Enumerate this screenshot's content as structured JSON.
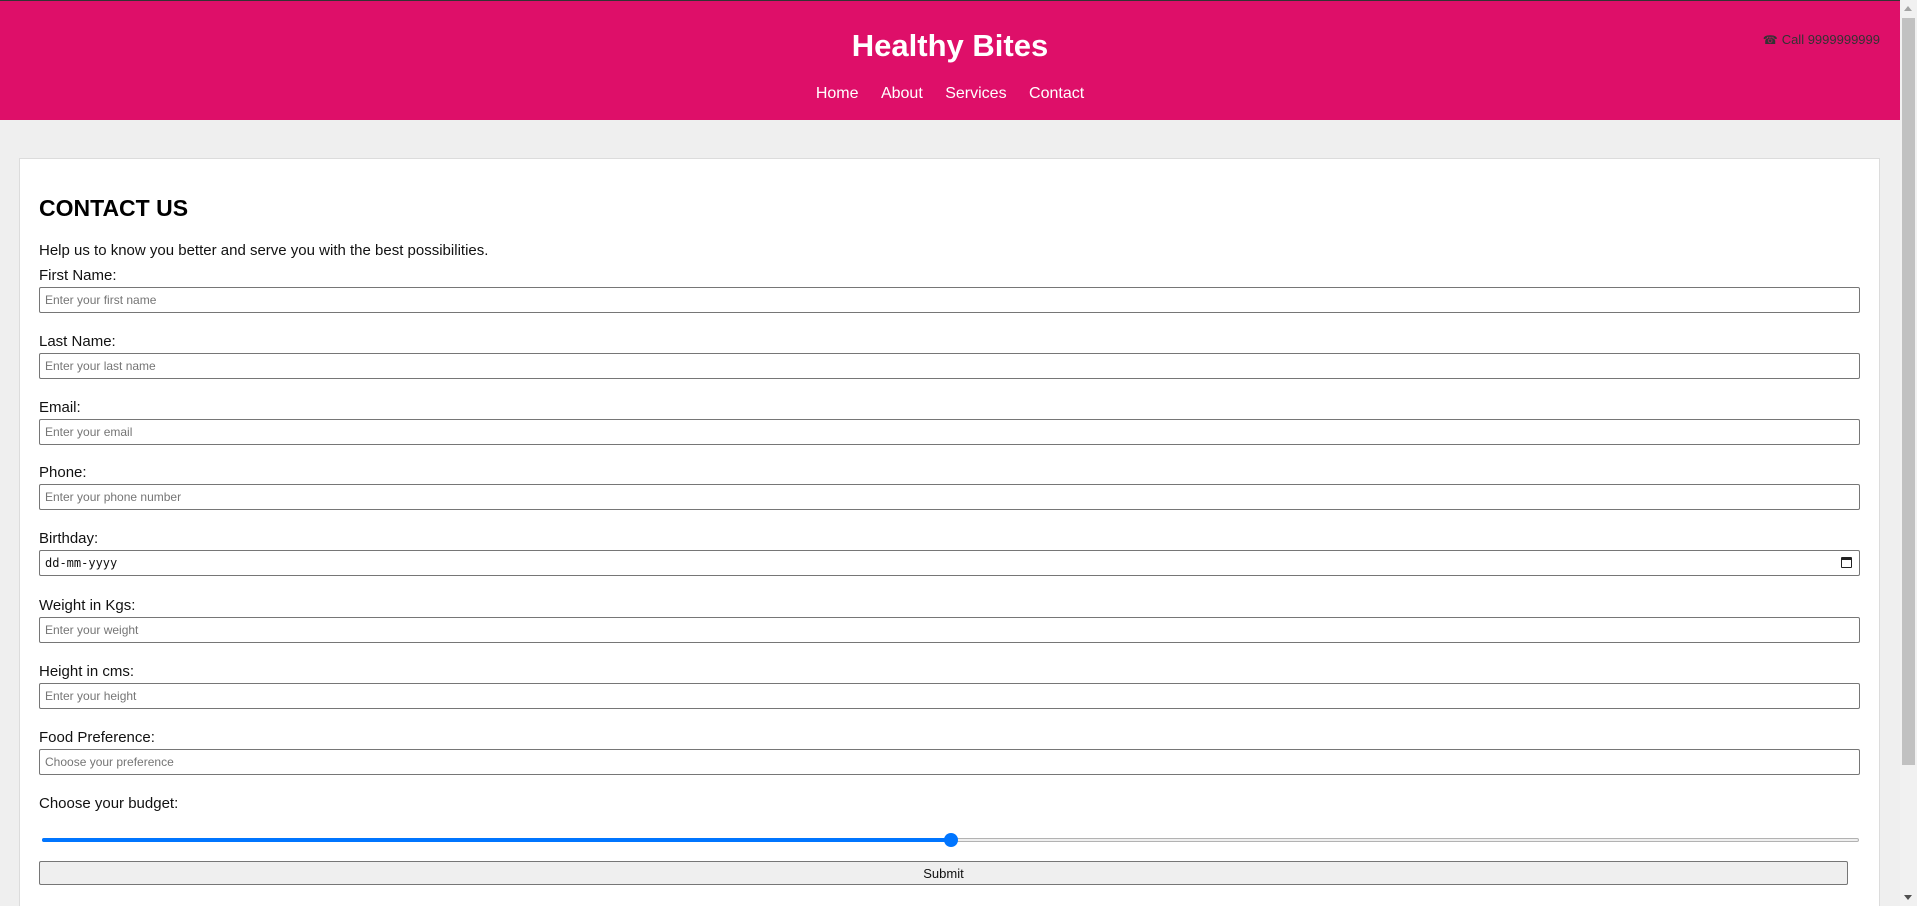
{
  "header": {
    "brand": "Healthy Bites",
    "nav": [
      "Home",
      "About",
      "Services",
      "Contact"
    ],
    "call_icon": "phone-icon",
    "call_text": "Call 9999999999"
  },
  "contact": {
    "title": "CONTACT US",
    "intro": "Help us to know you better and serve you with the best possibilities.",
    "fields": {
      "first_name": {
        "label": "First Name:",
        "placeholder": "Enter your first name"
      },
      "last_name": {
        "label": "Last Name:",
        "placeholder": "Enter your last name"
      },
      "email": {
        "label": "Email:",
        "placeholder": "Enter your email"
      },
      "phone": {
        "label": "Phone:",
        "placeholder": "Enter your phone number"
      },
      "birthday": {
        "label": "Birthday:",
        "value": "dd-mm-yyyy"
      },
      "weight": {
        "label": "Weight in Kgs:",
        "placeholder": "Enter your weight"
      },
      "height": {
        "label": "Height in cms:",
        "placeholder": "Enter your height"
      },
      "food": {
        "label": "Food Preference:",
        "placeholder": "Choose your preference"
      }
    },
    "budget": {
      "label": "Choose your budget:",
      "value_fraction": 0.5
    },
    "submit_label": "Submit"
  },
  "colors": {
    "header_bg": "#de0f69",
    "slider_accent": "#0075ff"
  }
}
